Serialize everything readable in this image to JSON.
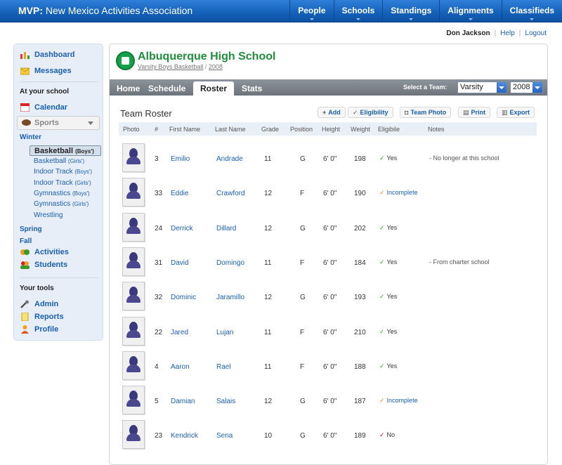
{
  "app": {
    "brand_prefix": "MVP:",
    "brand_name": "New Mexico Activities Association"
  },
  "topnav": [
    "People",
    "Schools",
    "Standings",
    "Alignments",
    "Classifieds"
  ],
  "user": {
    "name": "Don Jackson",
    "help": "Help",
    "logout": "Logout"
  },
  "sidebar": {
    "dashboard": "Dashboard",
    "messages": "Messages",
    "at_school": "At your school",
    "calendar": "Calendar",
    "sports": "Sports",
    "winter": "Winter",
    "sports_list": [
      {
        "name": "Basketball",
        "tag": "(Boys')"
      },
      {
        "name": "Basketball",
        "tag": "(Girls')"
      },
      {
        "name": "Indoor Track",
        "tag": "(Boys')"
      },
      {
        "name": "Indoor Track",
        "tag": "(Girls')"
      },
      {
        "name": "Gymnastics",
        "tag": "(Boys')"
      },
      {
        "name": "Gymnastics",
        "tag": "(Girls')"
      },
      {
        "name": "Wrestling",
        "tag": ""
      }
    ],
    "spring": "Spring",
    "fall": "Fall",
    "activities": "Activities",
    "students": "Students",
    "your_tools": "Your tools",
    "admin": "Admin",
    "reports": "Reports",
    "profile": "Profile"
  },
  "school": {
    "name": "Albuquerque High School",
    "team_link": "Varsity Boys Basketball",
    "sep": "/",
    "year_link": "2008"
  },
  "tabs": [
    "Home",
    "Schedule",
    "Roster",
    "Stats"
  ],
  "active_tab": "Roster",
  "team_select": {
    "label": "Select a Team:",
    "team": "Varsity",
    "year": "2008"
  },
  "roster": {
    "title": "Team Roster",
    "actions": [
      "Add",
      "Eligibility",
      "Team Photo",
      "Print",
      "Export"
    ],
    "headers": [
      "Photo",
      "#",
      "First Name",
      "Last Name",
      "Grade",
      "Position",
      "Height",
      "Weight",
      "Eligibile",
      "Notes"
    ],
    "rows": [
      {
        "num": "3",
        "first": "Emilio",
        "last": "Andrade",
        "grade": "11",
        "pos": "G",
        "height": "6' 0\"",
        "weight": "198",
        "elig": "Yes",
        "status": "ok",
        "notes": "- No longer at this school"
      },
      {
        "num": "33",
        "first": "Eddie",
        "last": "Crawford",
        "grade": "12",
        "pos": "F",
        "height": "6' 0\"",
        "weight": "190",
        "elig": "Incomplete",
        "status": "inc",
        "notes": ""
      },
      {
        "num": "24",
        "first": "Derrick",
        "last": "Dillard",
        "grade": "12",
        "pos": "G",
        "height": "6' 0\"",
        "weight": "202",
        "elig": "Yes",
        "status": "ok",
        "notes": ""
      },
      {
        "num": "31",
        "first": "David",
        "last": "Domingo",
        "grade": "11",
        "pos": "F",
        "height": "6' 0\"",
        "weight": "184",
        "elig": "Yes",
        "status": "ok",
        "notes": "- From charter school"
      },
      {
        "num": "32",
        "first": "Dominic",
        "last": "Jaramillo",
        "grade": "12",
        "pos": "G",
        "height": "6' 0\"",
        "weight": "193",
        "elig": "Yes",
        "status": "ok",
        "notes": ""
      },
      {
        "num": "22",
        "first": "Jared",
        "last": "Lujan",
        "grade": "11",
        "pos": "F",
        "height": "6' 0\"",
        "weight": "210",
        "elig": "Yes",
        "status": "ok",
        "notes": ""
      },
      {
        "num": "4",
        "first": "Aaron",
        "last": "Rael",
        "grade": "11",
        "pos": "F",
        "height": "6' 0\"",
        "weight": "188",
        "elig": "Yes",
        "status": "ok",
        "notes": ""
      },
      {
        "num": "5",
        "first": "Damian",
        "last": "Salais",
        "grade": "12",
        "pos": "G",
        "height": "6' 0\"",
        "weight": "187",
        "elig": "Incomplete",
        "status": "inc",
        "notes": ""
      },
      {
        "num": "23",
        "first": "Kendrick",
        "last": "Sena",
        "grade": "10",
        "pos": "G",
        "height": "6' 0\"",
        "weight": "189",
        "elig": "No",
        "status": "no",
        "notes": ""
      }
    ]
  },
  "colors": {
    "brand": "#1461b8",
    "school_green": "#1f8e3c",
    "link": "#1a5fb4",
    "eligible": "#3a9a2a",
    "incomplete": "#e08a19",
    "ineligible": "#cc1111"
  }
}
